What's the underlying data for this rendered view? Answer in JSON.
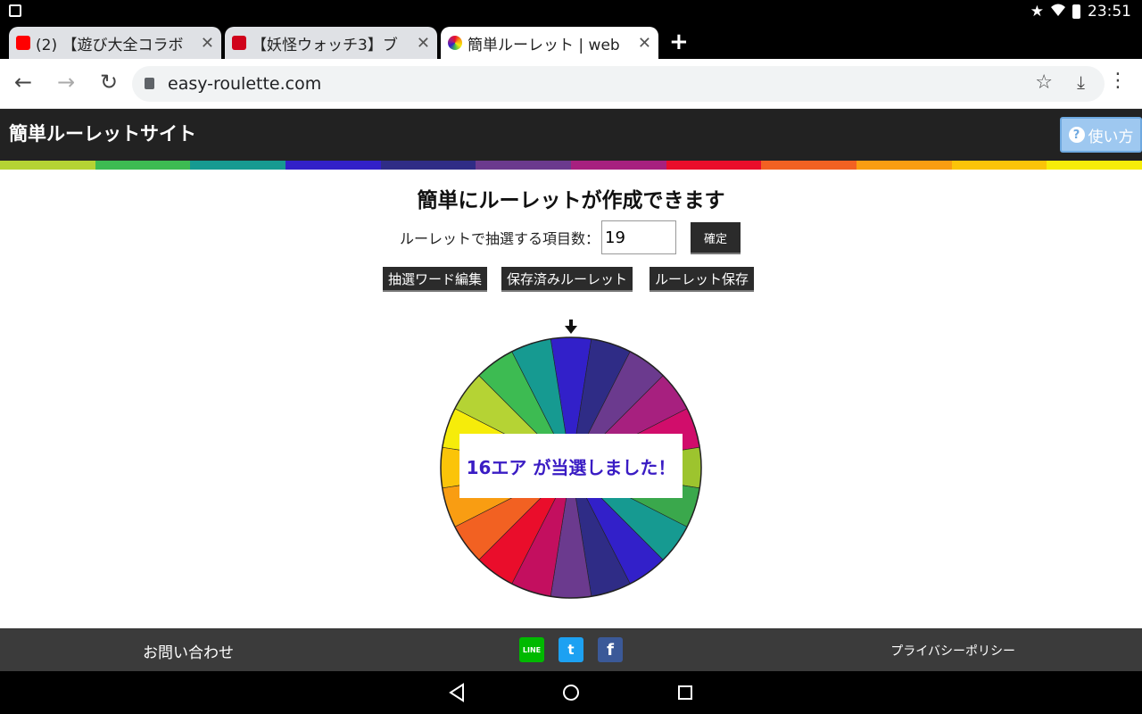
{
  "status_bar": {
    "time": "23:51"
  },
  "browser": {
    "tabs": [
      {
        "title": "(2) 【遊び大全コラボ",
        "favicon_color": "#ff0000",
        "active": false
      },
      {
        "title": "【妖怪ウォッチ3】ブ",
        "favicon_color": "#d0021b",
        "active": false
      },
      {
        "title": "簡単ルーレット | web",
        "favicon_color": "#3a78d8",
        "active": true
      }
    ],
    "url": "easy-roulette.com"
  },
  "site": {
    "title": "簡単ルーレットサイト",
    "howto_label": "使い方",
    "rainbow": [
      "#b5d334",
      "#3dbb52",
      "#169a91",
      "#3220c9",
      "#2f2c86",
      "#6b3a8e",
      "#a7207f",
      "#ea0d2b",
      "#f26122",
      "#f99d12",
      "#fbc409",
      "#f6ec0a"
    ]
  },
  "main": {
    "heading": "簡単にルーレットが作成できます",
    "count_label": "ルーレットで抽選する項目数：",
    "count_value": "19",
    "confirm_label": "確定",
    "buttons": {
      "edit_words": "抽選ワード編集",
      "saved": "保存済みルーレット",
      "save": "ルーレット保存"
    },
    "result_text": "16エア が当選しました！"
  },
  "wheel": {
    "segment_colors": [
      "#3220c9",
      "#2f2c86",
      "#6b3a8e",
      "#a7207f",
      "#d10d6b",
      "#9dc42e",
      "#3aa84c",
      "#169a91",
      "#3220c9",
      "#2f2c86",
      "#6b3a8e",
      "#c30f5f",
      "#ea0d2b",
      "#f26122",
      "#f99d12",
      "#fbc409",
      "#f6ec0a",
      "#b5d334",
      "#3dbb52",
      "#169a91"
    ]
  },
  "footer": {
    "contact": "お問い合わせ",
    "privacy": "プライバシーポリシー",
    "line_color": "#00b900",
    "twitter_color": "#1da1f2",
    "facebook_color": "#3b5998"
  }
}
